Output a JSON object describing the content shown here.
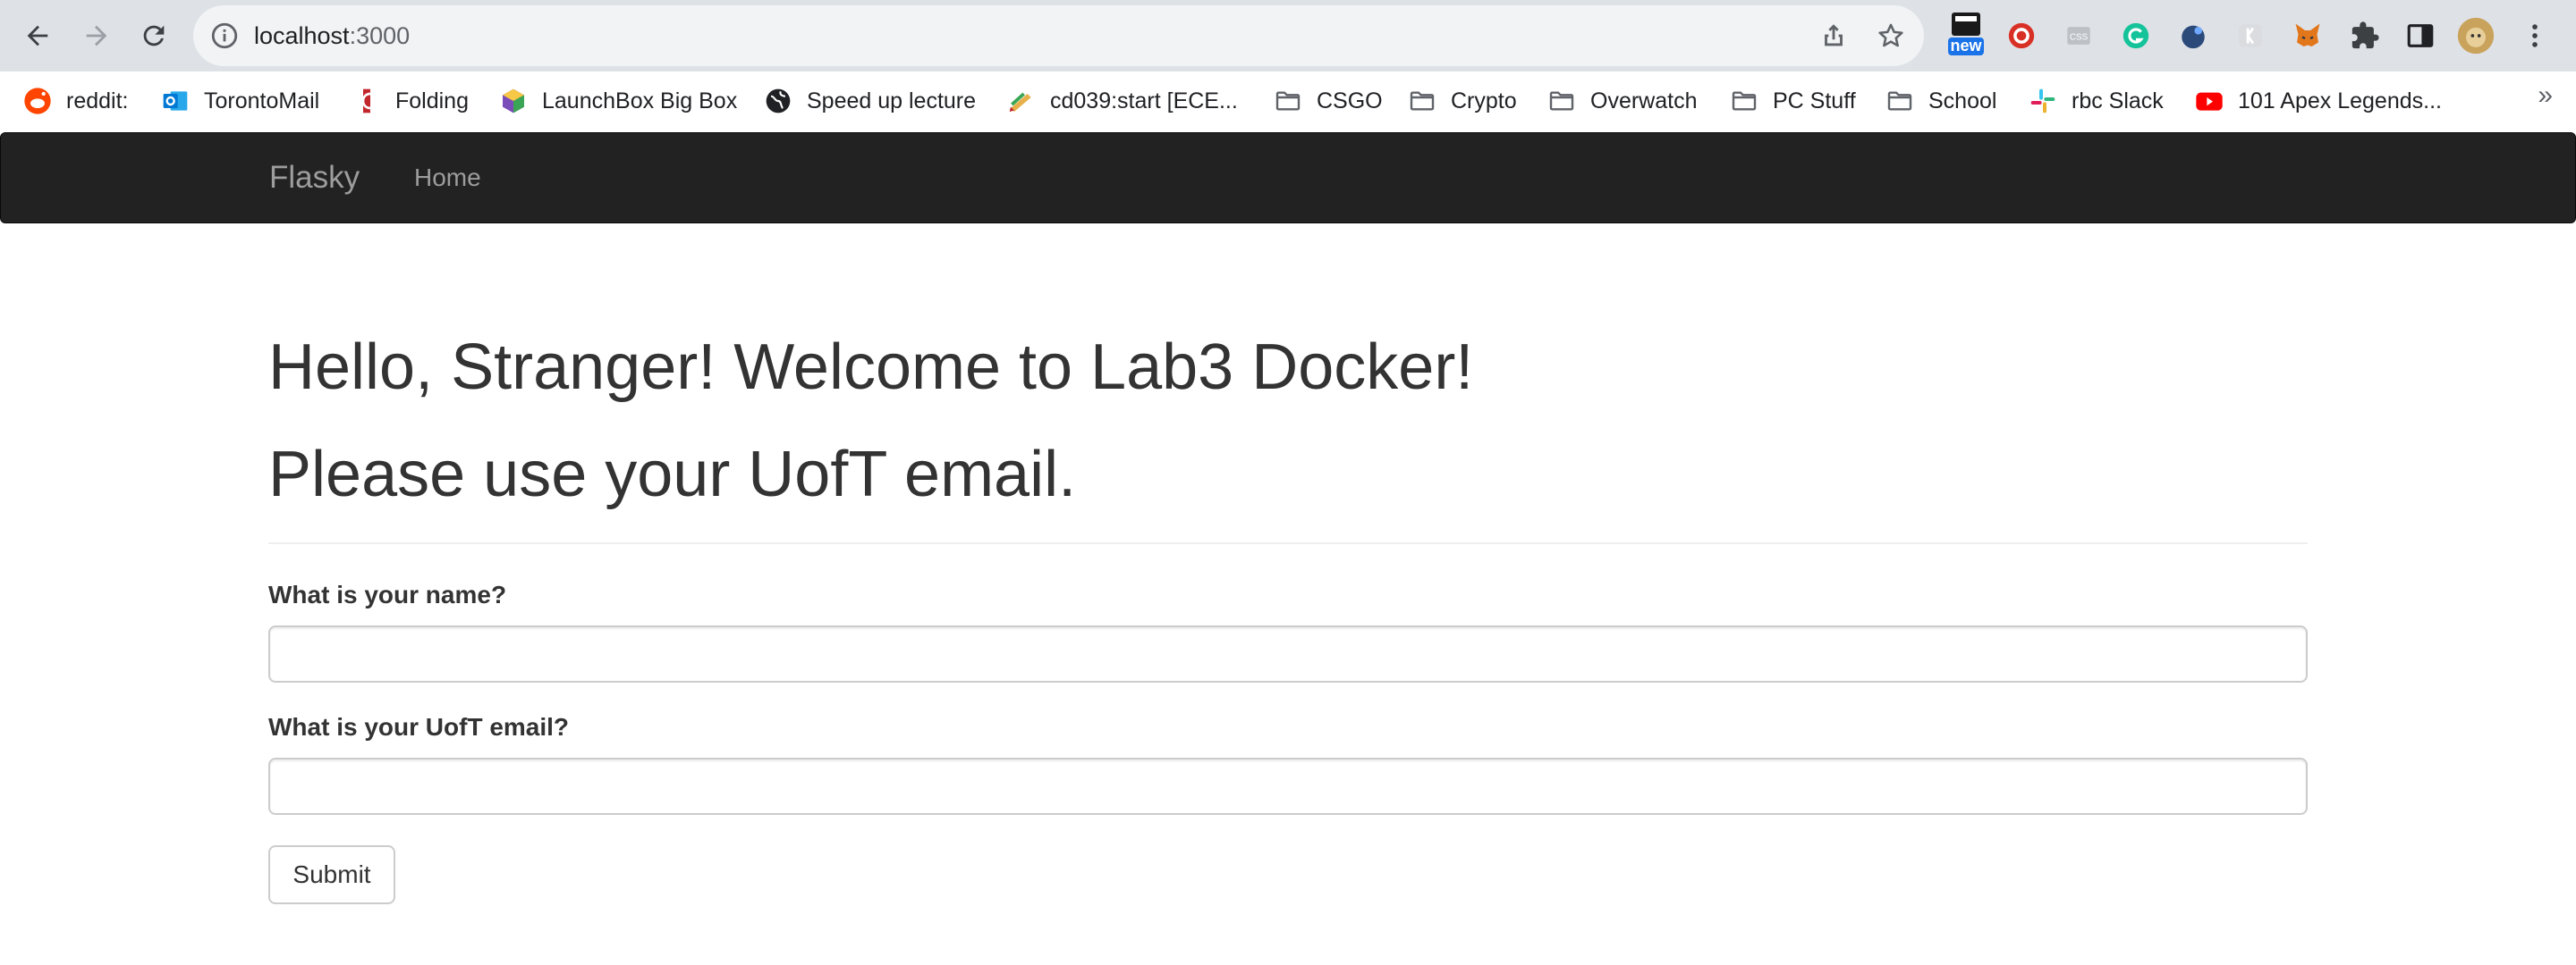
{
  "browser": {
    "url_host": "localhost",
    "url_port": ":3000",
    "back_icon": "back-arrow-icon",
    "forward_icon": "forward-arrow-icon",
    "reload_icon": "reload-icon",
    "info_icon": "info-icon",
    "share_icon": "share-icon",
    "star_icon": "bookmark-star-icon",
    "extension_badge": "new"
  },
  "bookmarks": [
    {
      "label": "reddit:",
      "icon": "reddit-icon"
    },
    {
      "label": "TorontoMail",
      "icon": "outlook-icon"
    },
    {
      "label": "Folding",
      "icon": "folding-icon"
    },
    {
      "label": "LaunchBox Big Box",
      "icon": "launchbox-icon"
    },
    {
      "label": "Speed up lecture",
      "icon": "globe-icon"
    },
    {
      "label": "cd039:start [ECE...",
      "icon": "wiki-icon"
    },
    {
      "label": "CSGO",
      "icon": "folder-icon"
    },
    {
      "label": "Crypto",
      "icon": "folder-icon"
    },
    {
      "label": "Overwatch",
      "icon": "folder-icon"
    },
    {
      "label": "PC Stuff",
      "icon": "folder-icon"
    },
    {
      "label": "School",
      "icon": "folder-icon"
    },
    {
      "label": "rbc Slack",
      "icon": "slack-icon"
    },
    {
      "label": "101 Apex Legends...",
      "icon": "youtube-icon"
    }
  ],
  "navbar": {
    "brand": "Flasky",
    "links": [
      "Home"
    ]
  },
  "page": {
    "greeting": "Hello, Stranger! Welcome to Lab3 Docker!",
    "instruction": "Please use your UofT email.",
    "form": {
      "name_label": "What is your name?",
      "name_value": "",
      "email_label": "What is your UofT email?",
      "email_value": "",
      "submit_label": "Submit"
    }
  },
  "colors": {
    "navbar_bg": "#222222",
    "navbar_text": "#9d9d9d",
    "heading_text": "#333333",
    "browser_toolbar": "#dee1e6"
  }
}
